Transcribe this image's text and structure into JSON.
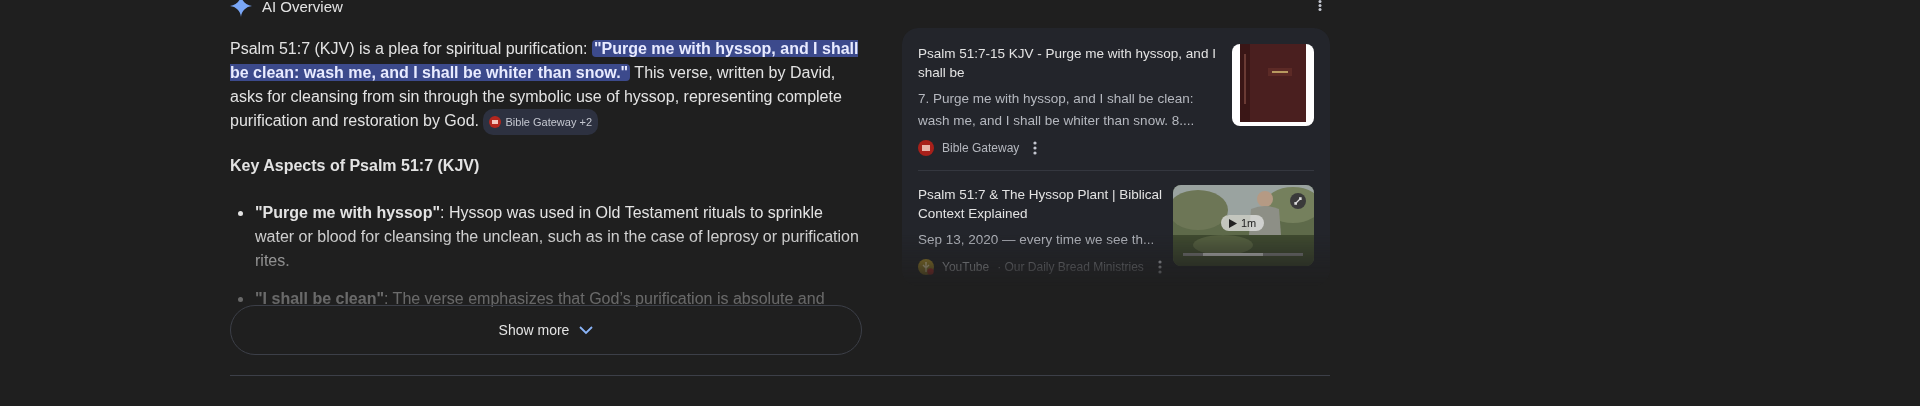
{
  "header": {
    "title": "AI Overview"
  },
  "summary": {
    "text": "Psalm 51:7 (KJV) is a plea for spiritual purification: **\"Purge me with hyssop, and I shall be clean: wash me, and I shall be whiter than snow.\"** This verse, written by David, asks for cleansing from sin through the symbolic use of hyssop, representing complete purification and restoration by God.",
    "chip": "Bible Gateway +2"
  },
  "heading": "Key Aspects of Psalm 51:7 (KJV)",
  "bullets": [
    {
      "text": "**\"Purge me with hyssop\"**: Hyssop was used in Old Testament rituals to sprinkle water or blood for cleansing the unclean, such as in the case of leprosy or purification rites."
    },
    {
      "text": "**\"I shall be clean\"**: The verse emphasizes that God’s purification is absolute and"
    }
  ],
  "show_more": {
    "label": "Show more"
  },
  "sources": [
    {
      "kind": "article",
      "title": "Psalm 51:7-15 KJV - Purge me with hyssop, and I shall be",
      "snippet": "7. Purge me with hyssop, and I shall be clean: wash me, and I shall be whiter than snow. 8....",
      "source": "Bible Gateway"
    },
    {
      "kind": "video",
      "title": "Psalm 51:7 & The Hyssop Plant | Biblical Context Explained",
      "snippet": "Sep 13, 2020 — every time we see th...",
      "source": "YouTube",
      "channel": "· Our Daily Bread Ministries",
      "duration": "1m"
    }
  ]
}
